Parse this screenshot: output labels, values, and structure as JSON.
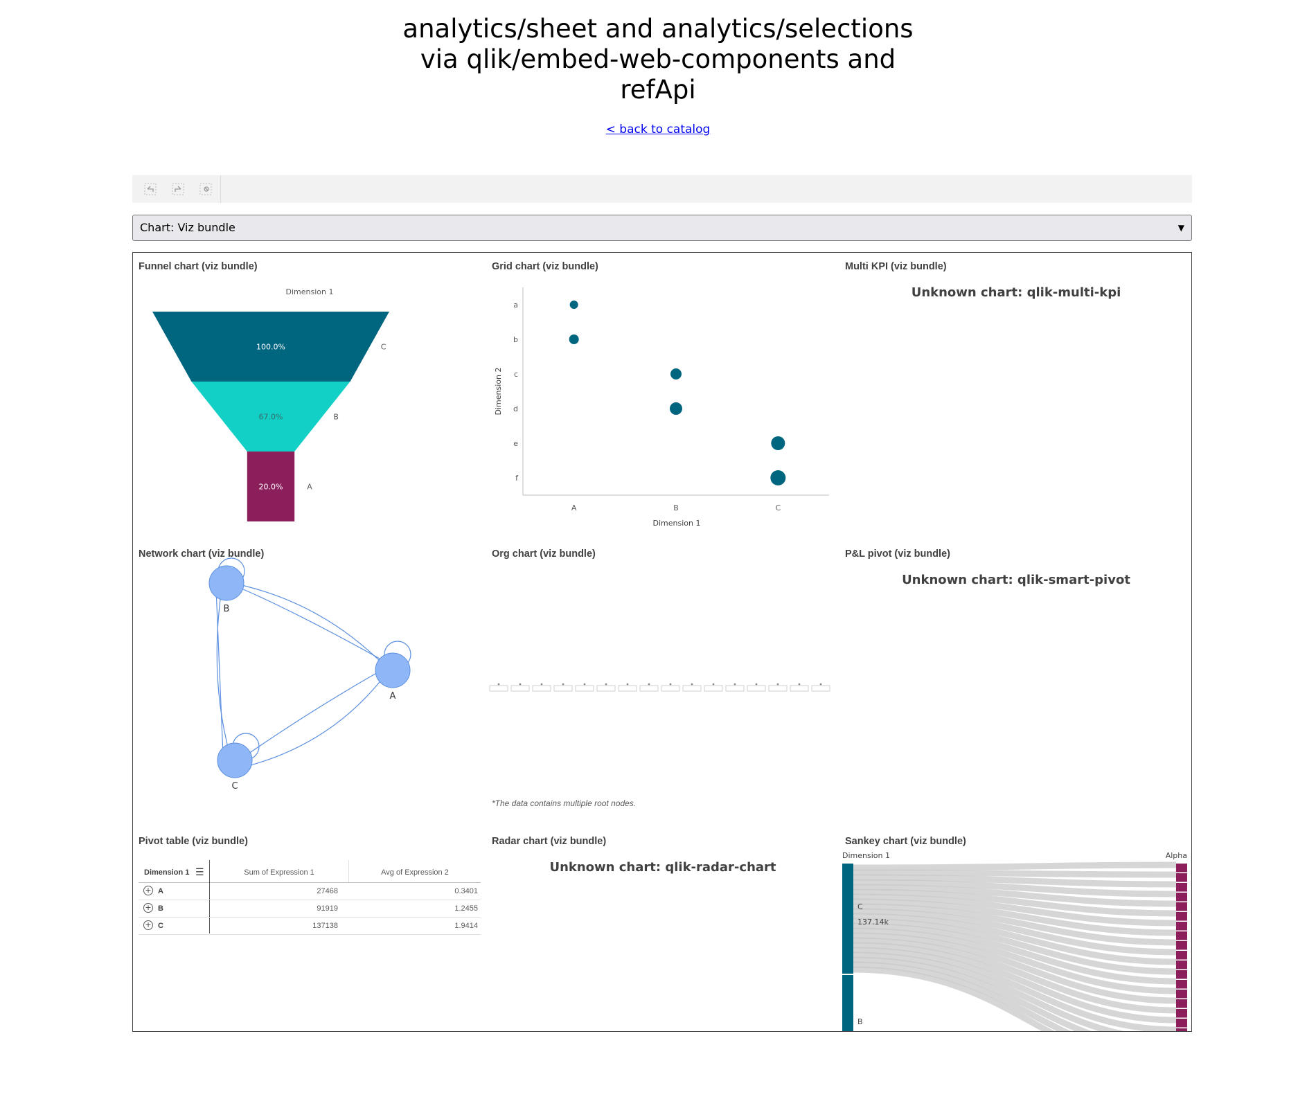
{
  "header": {
    "title_lines": [
      "analytics/sheet and analytics/selections",
      "via qlik/embed-web-components and",
      "refApi"
    ],
    "back_link": "< back to catalog"
  },
  "toolbar": {
    "icons": [
      "step-back-icon",
      "step-forward-icon",
      "clear-selections-icon"
    ]
  },
  "select": {
    "value": "Chart: Viz bundle"
  },
  "panels": {
    "funnel": {
      "title": "Funnel chart (viz bundle)",
      "chart_data": {
        "type": "funnel",
        "title": "Dimension 1",
        "categories": [
          "C",
          "B",
          "A"
        ],
        "values": [
          100.0,
          67.0,
          20.0
        ],
        "labels": [
          "100.0%",
          "67.0%",
          "20.0%"
        ],
        "colors": [
          "#00657e",
          "#13d0c6",
          "#8a1f5c"
        ]
      }
    },
    "grid": {
      "title": "Grid chart (viz bundle)",
      "chart_data": {
        "type": "scatter",
        "xlabel": "Dimension 1",
        "ylabel": "Dimension 2",
        "x_categories": [
          "A",
          "B",
          "C"
        ],
        "y_categories": [
          "a",
          "b",
          "c",
          "d",
          "e",
          "f"
        ],
        "points": [
          {
            "x": "A",
            "y": "a",
            "size": 1
          },
          {
            "x": "A",
            "y": "b",
            "size": 2
          },
          {
            "x": "B",
            "y": "c",
            "size": 3
          },
          {
            "x": "B",
            "y": "d",
            "size": 4
          },
          {
            "x": "C",
            "y": "e",
            "size": 5
          },
          {
            "x": "C",
            "y": "f",
            "size": 6
          }
        ],
        "color": "#00657e"
      }
    },
    "multikpi": {
      "title": "Multi KPI (viz bundle)",
      "message": "Unknown chart: qlik-multi-kpi"
    },
    "network": {
      "title": "Network chart (viz bundle)",
      "nodes": [
        "B",
        "A",
        "C"
      ],
      "color": "#8fb7f7"
    },
    "org": {
      "title": "Org chart (viz bundle)",
      "footnote": "*The data contains multiple root nodes."
    },
    "pl": {
      "title": "P&L pivot (viz bundle)",
      "message": "Unknown chart: qlik-smart-pivot"
    },
    "pivot": {
      "title": "Pivot table (viz bundle)",
      "headers": [
        "Dimension 1",
        "Sum of Expression 1",
        "Avg of Expression 2"
      ],
      "rows": [
        {
          "dim": "A",
          "sum": "27468",
          "avg": "0.3401"
        },
        {
          "dim": "B",
          "sum": "91919",
          "avg": "1.2455"
        },
        {
          "dim": "C",
          "sum": "137138",
          "avg": "1.9414"
        }
      ]
    },
    "radar": {
      "title": "Radar chart (viz bundle)",
      "message": "Unknown chart: qlik-radar-chart"
    },
    "sankey": {
      "title": "Sankey chart (viz bundle)",
      "left_label": "Dimension 1",
      "right_label": "Alpha",
      "nodes": [
        "C",
        "B"
      ],
      "value_label": "137.14k",
      "left_color": "#00657e",
      "right_color": "#8a1f5c"
    }
  }
}
